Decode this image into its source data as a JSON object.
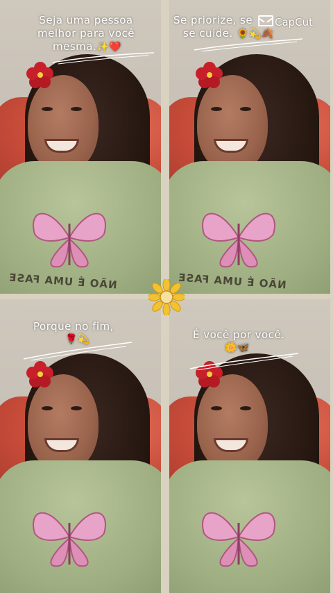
{
  "captions": {
    "panel1": [
      "Seja uma pessoa",
      "melhor para você",
      "mesma."
    ],
    "panel1_emoji": "✨❤️",
    "panel2": [
      "Se priorize, se",
      "se cuide."
    ],
    "panel2_emoji": "🌻💫🍂",
    "panel3": [
      "Porque no fim,"
    ],
    "panel3_emoji": "🌹💫",
    "panel4": [
      "É você por você."
    ],
    "panel4_emoji": "🌼🦋"
  },
  "shirt_text": "NÃO É UMA FASE",
  "watermark": "CapCut",
  "colors": {
    "sofa": "#c54a38",
    "shirt": "#9faf82",
    "butterfly": "#e7a3c8",
    "divider": "#d9d2c0",
    "flower_red": "#c7202a",
    "sunflower": "#f2c230"
  },
  "icons": {
    "hair_flower": "hibiscus-icon",
    "center": "sunflower-icon",
    "watermark": "capcut-logo-icon"
  }
}
